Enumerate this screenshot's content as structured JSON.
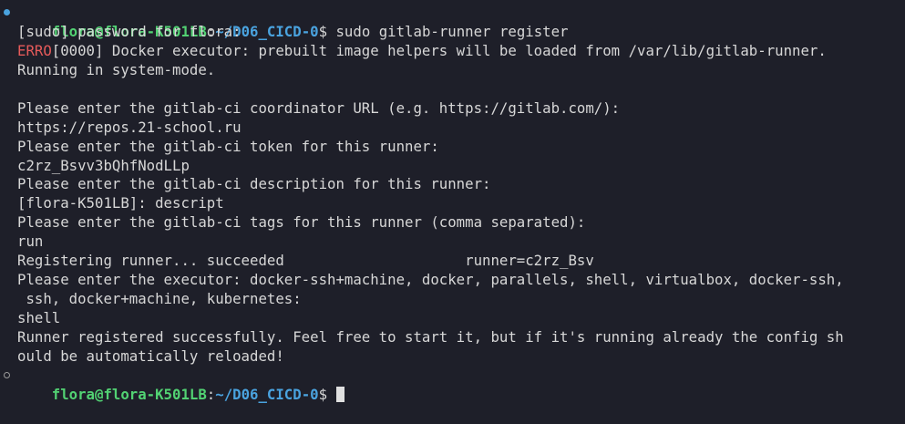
{
  "prompt": {
    "user_host": "flora@flora-K501LB",
    "colon": ":",
    "path": "~/D06_CICD-0",
    "symbol": "$"
  },
  "command": " sudo gitlab-runner register",
  "lines": {
    "l1": "[sudo] password for flora:",
    "l2_tag": "ERRO",
    "l2_rest": "[0000] Docker executor: prebuilt image helpers will be loaded from /var/lib/gitlab-runner.",
    "l3": "Running in system-mode.",
    "l4": "",
    "l5": "Please enter the gitlab-ci coordinator URL (e.g. https://gitlab.com/):",
    "l6": "https://repos.21-school.ru",
    "l7": "Please enter the gitlab-ci token for this runner:",
    "l8": "c2rz_Bsvv3bQhfNodLLp",
    "l9": "Please enter the gitlab-ci description for this runner:",
    "l10": "[flora-K501LB]: descript",
    "l11": "Please enter the gitlab-ci tags for this runner (comma separated):",
    "l12": "run",
    "l13": "Registering runner... succeeded                     runner=c2rz_Bsv",
    "l14": "Please enter the executor: docker-ssh+machine, docker, parallels, shell, virtualbox, docker-ssh,",
    "l15": " ssh, docker+machine, kubernetes:",
    "l16": "shell",
    "l17": "Runner registered successfully. Feel free to start it, but if it's running already the config sh",
    "l18": "ould be automatically reloaded!"
  },
  "colors": {
    "background": "#1e1f29",
    "user_host": "#52d273",
    "path": "#4aa3df",
    "error": "#e55a5a"
  }
}
